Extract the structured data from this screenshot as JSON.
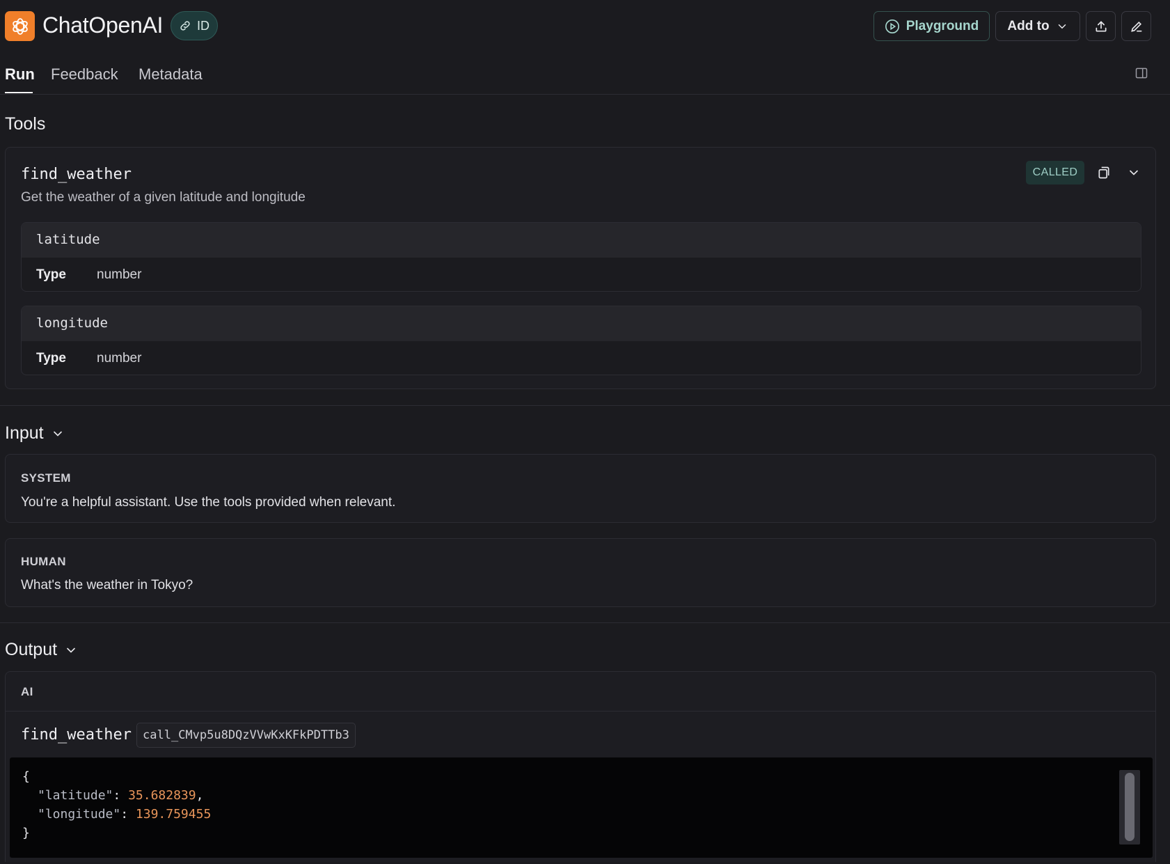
{
  "header": {
    "title": "ChatOpenAI",
    "id_badge": "ID",
    "playground_label": "Playground",
    "add_to_label": "Add to"
  },
  "tabs": [
    {
      "label": "Run",
      "active": true
    },
    {
      "label": "Feedback",
      "active": false
    },
    {
      "label": "Metadata",
      "active": false
    }
  ],
  "tools_section": {
    "title": "Tools",
    "tool": {
      "name": "find_weather",
      "description": "Get the weather of a given latitude and longitude",
      "status": "CALLED",
      "params": [
        {
          "name": "latitude",
          "type_label": "Type",
          "type_value": "number"
        },
        {
          "name": "longitude",
          "type_label": "Type",
          "type_value": "number"
        }
      ]
    }
  },
  "input_section": {
    "title": "Input",
    "messages": [
      {
        "role": "SYSTEM",
        "text": "You're a helpful assistant. Use the tools provided when relevant."
      },
      {
        "role": "HUMAN",
        "text": "What's the weather in Tokyo?"
      }
    ]
  },
  "output_section": {
    "title": "Output",
    "role": "AI",
    "tool_call": {
      "name": "find_weather",
      "call_id": "call_CMvp5u8DQzVVwKxKFkPDTTb3",
      "open_brace": "{",
      "close_brace": "}",
      "args": [
        {
          "key": "\"latitude\"",
          "value": "35.682839",
          "trailing": ","
        },
        {
          "key": "\"longitude\"",
          "value": "139.759455",
          "trailing": ""
        }
      ]
    }
  },
  "colors": {
    "background": "#1b1b1f",
    "logo": "#f07f2a",
    "accent_teal": "#a6d6cd",
    "number": "#e8955a"
  }
}
